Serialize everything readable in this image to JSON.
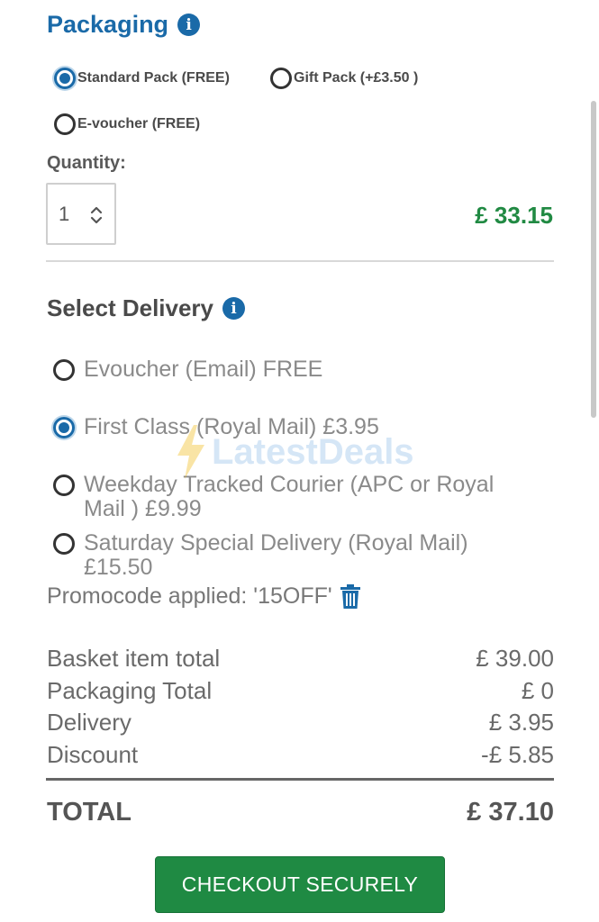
{
  "packaging": {
    "title": "Packaging",
    "options": [
      {
        "label": "Standard Pack (FREE)",
        "selected": true
      },
      {
        "label": "Gift Pack (+£3.50 )",
        "selected": false
      },
      {
        "label": "E-voucher (FREE)",
        "selected": false
      }
    ]
  },
  "quantity": {
    "label": "Quantity:",
    "value": "1",
    "price": "£ 33.15"
  },
  "delivery": {
    "title": "Select Delivery",
    "options": [
      {
        "label": "Evoucher (Email) FREE",
        "selected": false
      },
      {
        "label": "First Class (Royal Mail) £3.95",
        "selected": true
      },
      {
        "label": "Weekday Tracked Courier (APC or Royal Mail ) £9.99",
        "selected": false
      },
      {
        "label": "Saturday Special Delivery (Royal Mail) £15.50",
        "selected": false
      }
    ]
  },
  "promo": {
    "text": "Promocode applied: '15OFF'"
  },
  "summary": {
    "rows": [
      {
        "label": "Basket item total",
        "value": "£ 39.00"
      },
      {
        "label": "Packaging Total",
        "value": "£ 0"
      },
      {
        "label": "Delivery",
        "value": "£ 3.95"
      },
      {
        "label": "Discount",
        "value": "-£ 5.85"
      }
    ],
    "total_label": "TOTAL",
    "total_value": "£ 37.10"
  },
  "checkout": {
    "label": "CHECKOUT SECURELY"
  },
  "watermark": {
    "text": "LatestDeals"
  },
  "colors": {
    "accent_blue": "#1a6aa8",
    "price_green": "#218a43",
    "button_green": "#1f8a43"
  }
}
